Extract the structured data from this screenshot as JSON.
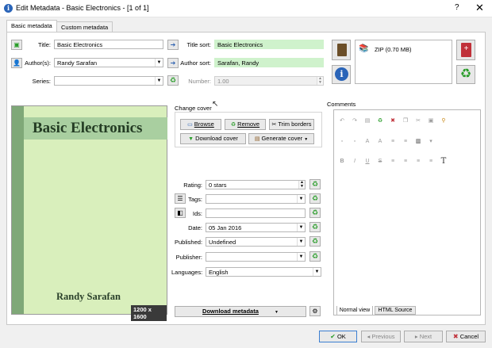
{
  "window": {
    "title": "Edit Metadata - Basic Electronics -  [1 of 1]",
    "help": "?",
    "close": "✕"
  },
  "tabs": [
    "Basic metadata",
    "Custom metadata"
  ],
  "fields": {
    "title_label": "Title:",
    "title_value": "Basic Electronics",
    "title_sort_label": "Title sort:",
    "title_sort_value": "Basic Electronics",
    "authors_label": "Author(s):",
    "authors_value": "Randy Sarafan",
    "author_sort_label": "Author sort:",
    "author_sort_value": "Sarafan, Randy",
    "series_label": "Series:",
    "series_value": "",
    "number_label": "Number:",
    "number_value": "1.00"
  },
  "format": {
    "label": "ZIP (0.70 MB)"
  },
  "change_cover": {
    "label": "Change cover",
    "browse": "Browse",
    "remove": "Remove",
    "trim": "Trim borders",
    "download": "Download cover",
    "generate": "Generate cover"
  },
  "cover": {
    "title": "Basic Electronics",
    "author": "Randy Sarafan",
    "size": "1200 x 1600"
  },
  "meta": {
    "rating_label": "Rating:",
    "rating_value": "0 stars",
    "tags_label": "Tags:",
    "tags_value": "",
    "ids_label": "Ids:",
    "ids_value": "",
    "date_label": "Date:",
    "date_value": "05 Jan 2016",
    "published_label": "Published:",
    "published_value": "Undefined",
    "publisher_label": "Publisher:",
    "publisher_value": "",
    "languages_label": "Languages:",
    "languages_value": "English"
  },
  "download_metadata": "Download metadata",
  "comments": {
    "label": "Comments",
    "normal_view": "Normal view",
    "html_source": "HTML Source"
  },
  "footer": {
    "ok": "OK",
    "previous": "Previous",
    "next": "Next",
    "cancel": "Cancel"
  },
  "colors": {
    "sort_field_bg": "#cff2cc",
    "cover_bg": "#d9efbc",
    "accent": "#2a64b8"
  }
}
